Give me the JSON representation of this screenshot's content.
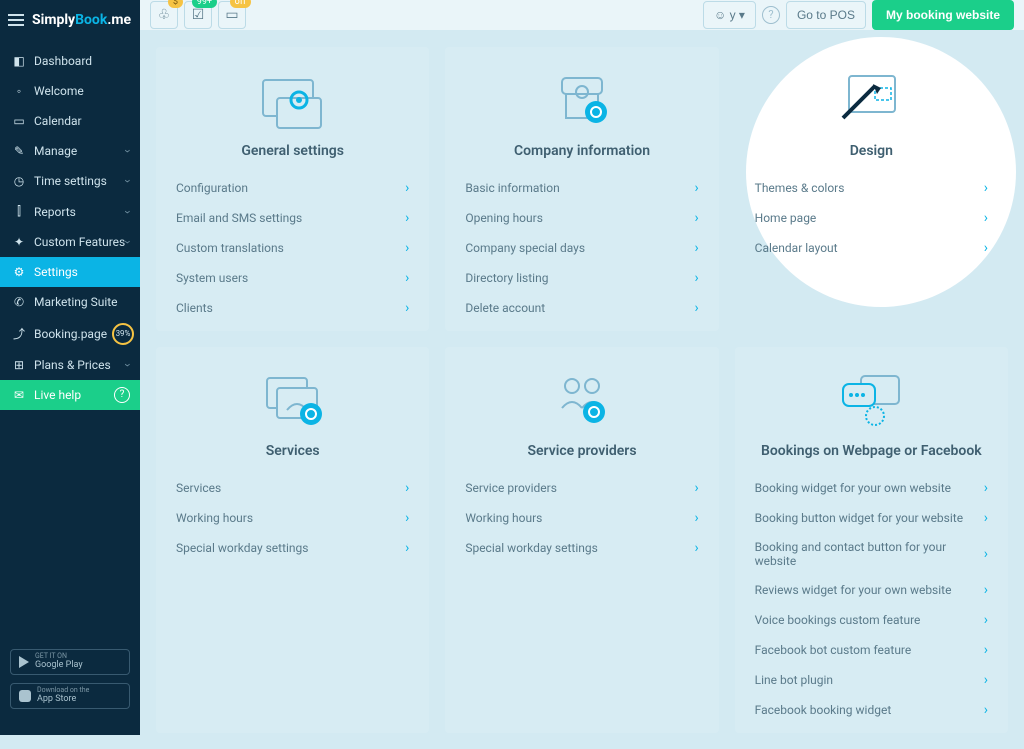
{
  "brand": {
    "p1": "Simply",
    "p2": "Book",
    "p3": ".me"
  },
  "header": {
    "bell_badge": "$",
    "box_badge": "99+",
    "cal_badge": "off",
    "user_label": "y",
    "go_to_pos": "Go to POS",
    "primary_btn": "My booking website"
  },
  "sidebar": {
    "items": [
      {
        "icon": "◧",
        "label": "Dashboard"
      },
      {
        "icon": "◦",
        "label": "Welcome"
      },
      {
        "icon": "▭",
        "label": "Calendar"
      },
      {
        "icon": "✎",
        "label": "Manage",
        "chev": true
      },
      {
        "icon": "◷",
        "label": "Time settings",
        "chev": true
      },
      {
        "icon": "⫿",
        "label": "Reports",
        "chev": true
      },
      {
        "icon": "✦",
        "label": "Custom Features",
        "chev": true
      },
      {
        "icon": "⚙",
        "label": "Settings"
      },
      {
        "icon": "✆",
        "label": "Marketing Suite"
      },
      {
        "icon": "⤴",
        "label": "Booking.page",
        "pct": "39%"
      },
      {
        "icon": "⊞",
        "label": "Plans & Prices",
        "chev": true
      },
      {
        "icon": "✉",
        "label": "Live help"
      }
    ],
    "store1_small": "GET IT ON",
    "store1": "Google Play",
    "store2_small": "Download on the",
    "store2": "App Store"
  },
  "cards": [
    {
      "title": "General settings",
      "items": [
        "Configuration",
        "Email and SMS settings",
        "Custom translations",
        "System users",
        "Clients"
      ]
    },
    {
      "title": "Company information",
      "items": [
        "Basic information",
        "Opening hours",
        "Company special days",
        "Directory listing",
        "Delete account"
      ]
    },
    {
      "title": "Design",
      "items": [
        "Themes & colors",
        "Home page",
        "Calendar layout"
      ]
    },
    {
      "title": "Services",
      "items": [
        "Services",
        "Working hours",
        "Special workday settings"
      ]
    },
    {
      "title": "Service providers",
      "items": [
        "Service providers",
        "Working hours",
        "Special workday settings"
      ]
    },
    {
      "title": "Bookings on Webpage or Facebook",
      "items": [
        "Booking widget for your own website",
        "Booking button widget for your website",
        "Booking and contact button for your website",
        "Reviews widget for your own website",
        "Voice bookings custom feature",
        "Facebook bot custom feature",
        "Line bot plugin",
        "Facebook booking widget"
      ]
    }
  ]
}
